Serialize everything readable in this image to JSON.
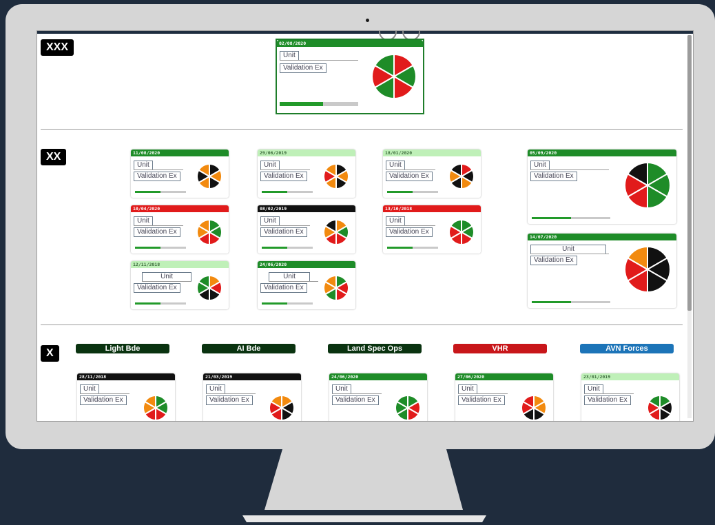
{
  "colors": {
    "green": "#1e8c28",
    "red": "#e11b1b",
    "black": "#111111",
    "orange": "#f28a0f",
    "light_green": "#bff0b8",
    "dark_green": "#0a3310",
    "blue": "#1c74b8",
    "dark_red": "#c8161a"
  },
  "levels": {
    "xxx": "XXX",
    "xx": "XX",
    "x": "X"
  },
  "main_card": {
    "date": "02/08/2020",
    "unit": "Unit",
    "validation": "Validation Ex",
    "progress": 0.55,
    "pie": [
      "red",
      "green",
      "red",
      "green",
      "red",
      "green"
    ]
  },
  "xx_cards": [
    {
      "date": "11/08/2020",
      "head": "green",
      "unit": "Unit",
      "validation": "Validation Ex",
      "progress": 0.5,
      "pie": [
        "black",
        "orange",
        "black",
        "orange",
        "black",
        "orange"
      ]
    },
    {
      "date": "29/06/2019",
      "head": "light_green",
      "unit": "Unit",
      "validation": "Validation Ex",
      "progress": 0.5,
      "pie": [
        "black",
        "orange",
        "black",
        "orange",
        "red",
        "orange"
      ]
    },
    {
      "date": "18/01/2020",
      "head": "light_green",
      "unit": "Unit",
      "validation": "Validation Ex",
      "progress": 0.5,
      "pie": [
        "red",
        "black",
        "orange",
        "black",
        "orange",
        "black"
      ]
    },
    {
      "date": "05/09/2020",
      "head": "green",
      "unit": "Unit",
      "validation": "Validation Ex",
      "progress": 0.5,
      "pie": [
        "green",
        "green",
        "green",
        "red",
        "red",
        "black"
      ]
    },
    {
      "date": "10/04/2020",
      "head": "red",
      "unit": "Unit",
      "validation": "Validation Ex",
      "progress": 0.5,
      "pie": [
        "green",
        "green",
        "red",
        "red",
        "orange",
        "orange"
      ]
    },
    {
      "date": "08/02/2019",
      "head": "black",
      "unit": "Unit",
      "validation": "Validation Ex",
      "progress": 0.5,
      "pie": [
        "orange",
        "green",
        "red",
        "red",
        "orange",
        "black"
      ]
    },
    {
      "date": "13/10/2018",
      "head": "red",
      "unit": "Unit",
      "validation": "Validation Ex",
      "progress": 0.5,
      "pie": [
        "green",
        "green",
        "red",
        "red",
        "red",
        "green"
      ]
    },
    {
      "date": "14/07/2020",
      "head": "green",
      "unit": "Unit",
      "validation": "Validation Ex",
      "progress": 0.5,
      "pie": [
        "black",
        "black",
        "black",
        "red",
        "red",
        "orange"
      ]
    },
    {
      "date": "12/11/2018",
      "head": "light_green",
      "unit": "Unit",
      "validation": "Validation Ex",
      "progress": 0.5,
      "pie": [
        "orange",
        "red",
        "black",
        "black",
        "green",
        "green"
      ]
    },
    {
      "date": "24/06/2020",
      "head": "green",
      "unit": "Unit",
      "validation": "Validation Ex",
      "progress": 0.5,
      "pie": [
        "green",
        "red",
        "red",
        "green",
        "orange",
        "orange"
      ]
    }
  ],
  "formations": [
    {
      "label": "Light Bde",
      "color": "dark_green"
    },
    {
      "label": "AI Bde",
      "color": "dark_green"
    },
    {
      "label": "Land Spec Ops",
      "color": "dark_green"
    },
    {
      "label": "VHR",
      "color": "dark_red"
    },
    {
      "label": "AVN Forces",
      "color": "blue"
    }
  ],
  "x_cards": [
    {
      "date": "28/11/2018",
      "head": "black",
      "unit": "Unit",
      "validation": "Validation Ex",
      "pie": [
        "green",
        "green",
        "red",
        "red",
        "orange",
        "orange"
      ]
    },
    {
      "date": "21/03/2019",
      "head": "black",
      "unit": "Unit",
      "validation": "Validation Ex",
      "pie": [
        "orange",
        "black",
        "black",
        "red",
        "red",
        "orange"
      ]
    },
    {
      "date": "24/06/2020",
      "head": "green",
      "unit": "Unit",
      "validation": "Validation Ex",
      "pie": [
        "green",
        "red",
        "red",
        "green",
        "green",
        "green"
      ]
    },
    {
      "date": "27/06/2020",
      "head": "green",
      "unit": "Unit",
      "validation": "Validation Ex",
      "pie": [
        "orange",
        "orange",
        "black",
        "black",
        "red",
        "red"
      ]
    },
    {
      "date": "23/01/2019",
      "head": "light_green",
      "unit": "Unit",
      "validation": "Validation Ex",
      "pie": [
        "green",
        "black",
        "black",
        "red",
        "red",
        "green"
      ]
    }
  ]
}
